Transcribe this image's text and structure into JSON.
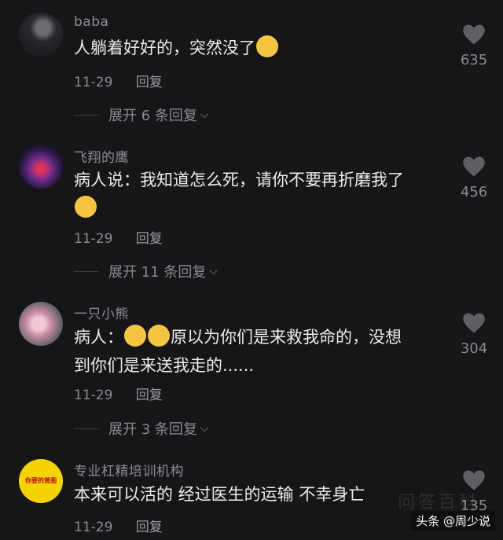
{
  "comments": [
    {
      "username": "baba",
      "text": "人躺着好好的，突然没了",
      "date": "11-29",
      "reply_label": "回复",
      "expand_label": "展开 6 条回复",
      "likes": "635"
    },
    {
      "username": "飞翔的鹰",
      "text": "病人说：我知道怎么死，请你不要再折磨我了",
      "date": "11-29",
      "reply_label": "回复",
      "expand_label": "展开 11 条回复",
      "likes": "456"
    },
    {
      "username": "一只小熊",
      "text_line1": "病人：",
      "text_line1b": "原以为你们是来救我命的，没想",
      "text_line2": "到你们是来送我走的......",
      "date": "11-29",
      "reply_label": "回复",
      "expand_label": "展开 3 条回复",
      "likes": "304"
    },
    {
      "username": "专业杠精培训机构",
      "text": "本来可以活的 经过医生的运输 不幸身亡",
      "date": "11-29",
      "reply_label": "回复",
      "likes": "135",
      "avatar_text": "你要的黄图"
    }
  ],
  "watermark": "头条 @周少说",
  "watermark_ghost": "问答百科",
  "colors": {
    "background": "#161618",
    "text": "#ececed",
    "muted": "#8a8a8f",
    "emoji": "#f5c542"
  }
}
